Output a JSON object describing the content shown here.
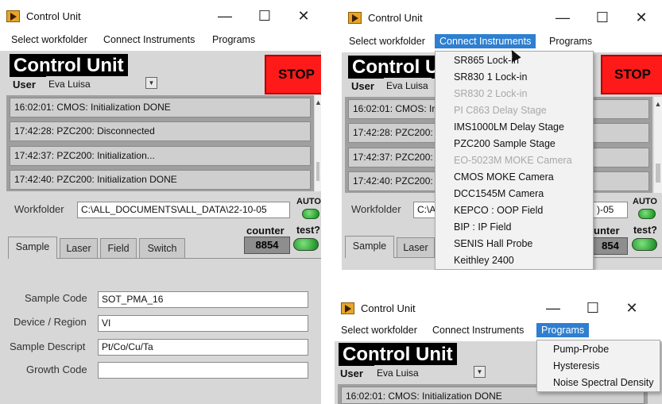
{
  "window": {
    "title": "Control Unit",
    "controls": {
      "minimize": "—",
      "maximize": "☐",
      "close": "✕"
    }
  },
  "menu": {
    "select_workfolder": "Select workfolder",
    "connect_instruments": "Connect Instruments",
    "programs": "Programs"
  },
  "panel": {
    "title": "Control Unit",
    "user_label": "User",
    "user_value": "Eva Luisa",
    "stop_label": "STOP",
    "log": [
      "16:02:01: CMOS: Initialization DONE",
      "17:42:28: PZC200:  Disconnected",
      "17:42:37: PZC200: Initialization...",
      "17:42:40: PZC200: Initialization DONE"
    ],
    "workfolder_label": "Workfolder",
    "workfolder_value": "C:\\ALL_DOCUMENTS\\ALL_DATA\\22-10-05",
    "auto_label": "AUTO",
    "counter_label": "counter",
    "counter_value": "8854",
    "test_label": "test?",
    "tabs": [
      "Sample",
      "Laser",
      "Field",
      "Switch"
    ],
    "sample": {
      "code_label": "Sample Code",
      "code_value": "SOT_PMA_16",
      "device_label": "Device / Region",
      "device_value": "VI",
      "descript_label": "Sample Descript",
      "descript_value": "Pt/Co/Cu/Ta",
      "growth_label": "Growth Code",
      "growth_value": ""
    }
  },
  "partial": {
    "log0": "16:02:01: CMOS: Ir",
    "log1": "17:42:28: PZC200:",
    "log2": "17:42:37: PZC200:",
    "log3": "17:42:40: PZC200:",
    "workfolder_value": "C:\\A",
    "workfolder_tail": ")-05",
    "counter_label": "unter",
    "counter_value": "854",
    "log_bottom": "16:02:01: CMOS: Initialization DONE"
  },
  "connect_menu": {
    "items": [
      {
        "label": "SR865 Lock-in",
        "enabled": true
      },
      {
        "label": "SR830 1 Lock-in",
        "enabled": true
      },
      {
        "label": "SR830 2 Lock-in",
        "enabled": false
      },
      {
        "label": "PI C863 Delay Stage",
        "enabled": false
      },
      {
        "label": "IMS1000LM Delay Stage",
        "enabled": true
      },
      {
        "label": "PZC200 Sample Stage",
        "enabled": true
      },
      {
        "label": "EO-5023M  MOKE Camera",
        "enabled": false
      },
      {
        "label": "CMOS MOKE Camera",
        "enabled": true
      },
      {
        "label": "DCC1545M Camera",
        "enabled": true
      },
      {
        "label": "KEPCO : OOP Field",
        "enabled": true
      },
      {
        "label": "BIP : IP Field",
        "enabled": true
      },
      {
        "label": "SENIS Hall Probe",
        "enabled": true
      },
      {
        "label": "Keithley 2400",
        "enabled": true
      }
    ]
  },
  "programs_menu": {
    "items": [
      "Pump-Probe",
      "Hysteresis",
      "Noise Spectral Density"
    ]
  },
  "colors": {
    "menu_highlight": "#2e7fd0",
    "stop": "#ff1a1a",
    "led": "#1aa31a"
  }
}
